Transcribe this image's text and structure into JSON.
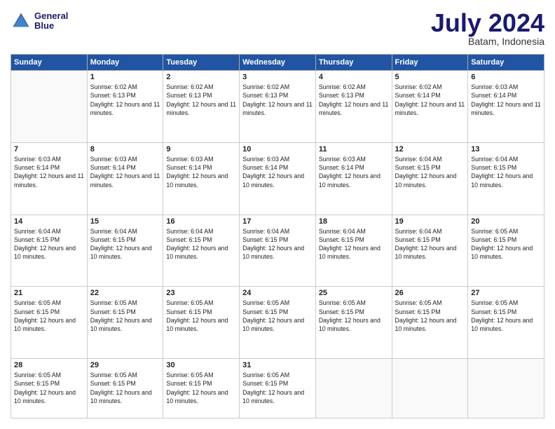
{
  "header": {
    "logo": {
      "line1": "General",
      "line2": "Blue"
    },
    "title": "July 2024",
    "location": "Batam, Indonesia"
  },
  "weekdays": [
    "Sunday",
    "Monday",
    "Tuesday",
    "Wednesday",
    "Thursday",
    "Friday",
    "Saturday"
  ],
  "weeks": [
    [
      {
        "day": null
      },
      {
        "day": 1,
        "sunrise": "6:02 AM",
        "sunset": "6:13 PM",
        "daylight": "12 hours and 11 minutes."
      },
      {
        "day": 2,
        "sunrise": "6:02 AM",
        "sunset": "6:13 PM",
        "daylight": "12 hours and 11 minutes."
      },
      {
        "day": 3,
        "sunrise": "6:02 AM",
        "sunset": "6:13 PM",
        "daylight": "12 hours and 11 minutes."
      },
      {
        "day": 4,
        "sunrise": "6:02 AM",
        "sunset": "6:13 PM",
        "daylight": "12 hours and 11 minutes."
      },
      {
        "day": 5,
        "sunrise": "6:02 AM",
        "sunset": "6:14 PM",
        "daylight": "12 hours and 11 minutes."
      },
      {
        "day": 6,
        "sunrise": "6:03 AM",
        "sunset": "6:14 PM",
        "daylight": "12 hours and 11 minutes."
      }
    ],
    [
      {
        "day": 7,
        "sunrise": "6:03 AM",
        "sunset": "6:14 PM",
        "daylight": "12 hours and 11 minutes."
      },
      {
        "day": 8,
        "sunrise": "6:03 AM",
        "sunset": "6:14 PM",
        "daylight": "12 hours and 11 minutes."
      },
      {
        "day": 9,
        "sunrise": "6:03 AM",
        "sunset": "6:14 PM",
        "daylight": "12 hours and 10 minutes."
      },
      {
        "day": 10,
        "sunrise": "6:03 AM",
        "sunset": "6:14 PM",
        "daylight": "12 hours and 10 minutes."
      },
      {
        "day": 11,
        "sunrise": "6:03 AM",
        "sunset": "6:14 PM",
        "daylight": "12 hours and 10 minutes."
      },
      {
        "day": 12,
        "sunrise": "6:04 AM",
        "sunset": "6:15 PM",
        "daylight": "12 hours and 10 minutes."
      },
      {
        "day": 13,
        "sunrise": "6:04 AM",
        "sunset": "6:15 PM",
        "daylight": "12 hours and 10 minutes."
      }
    ],
    [
      {
        "day": 14,
        "sunrise": "6:04 AM",
        "sunset": "6:15 PM",
        "daylight": "12 hours and 10 minutes."
      },
      {
        "day": 15,
        "sunrise": "6:04 AM",
        "sunset": "6:15 PM",
        "daylight": "12 hours and 10 minutes."
      },
      {
        "day": 16,
        "sunrise": "6:04 AM",
        "sunset": "6:15 PM",
        "daylight": "12 hours and 10 minutes."
      },
      {
        "day": 17,
        "sunrise": "6:04 AM",
        "sunset": "6:15 PM",
        "daylight": "12 hours and 10 minutes."
      },
      {
        "day": 18,
        "sunrise": "6:04 AM",
        "sunset": "6:15 PM",
        "daylight": "12 hours and 10 minutes."
      },
      {
        "day": 19,
        "sunrise": "6:04 AM",
        "sunset": "6:15 PM",
        "daylight": "12 hours and 10 minutes."
      },
      {
        "day": 20,
        "sunrise": "6:05 AM",
        "sunset": "6:15 PM",
        "daylight": "12 hours and 10 minutes."
      }
    ],
    [
      {
        "day": 21,
        "sunrise": "6:05 AM",
        "sunset": "6:15 PM",
        "daylight": "12 hours and 10 minutes."
      },
      {
        "day": 22,
        "sunrise": "6:05 AM",
        "sunset": "6:15 PM",
        "daylight": "12 hours and 10 minutes."
      },
      {
        "day": 23,
        "sunrise": "6:05 AM",
        "sunset": "6:15 PM",
        "daylight": "12 hours and 10 minutes."
      },
      {
        "day": 24,
        "sunrise": "6:05 AM",
        "sunset": "6:15 PM",
        "daylight": "12 hours and 10 minutes."
      },
      {
        "day": 25,
        "sunrise": "6:05 AM",
        "sunset": "6:15 PM",
        "daylight": "12 hours and 10 minutes."
      },
      {
        "day": 26,
        "sunrise": "6:05 AM",
        "sunset": "6:15 PM",
        "daylight": "12 hours and 10 minutes."
      },
      {
        "day": 27,
        "sunrise": "6:05 AM",
        "sunset": "6:15 PM",
        "daylight": "12 hours and 10 minutes."
      }
    ],
    [
      {
        "day": 28,
        "sunrise": "6:05 AM",
        "sunset": "6:15 PM",
        "daylight": "12 hours and 10 minutes."
      },
      {
        "day": 29,
        "sunrise": "6:05 AM",
        "sunset": "6:15 PM",
        "daylight": "12 hours and 10 minutes."
      },
      {
        "day": 30,
        "sunrise": "6:05 AM",
        "sunset": "6:15 PM",
        "daylight": "12 hours and 10 minutes."
      },
      {
        "day": 31,
        "sunrise": "6:05 AM",
        "sunset": "6:15 PM",
        "daylight": "12 hours and 10 minutes."
      },
      {
        "day": null
      },
      {
        "day": null
      },
      {
        "day": null
      }
    ]
  ]
}
